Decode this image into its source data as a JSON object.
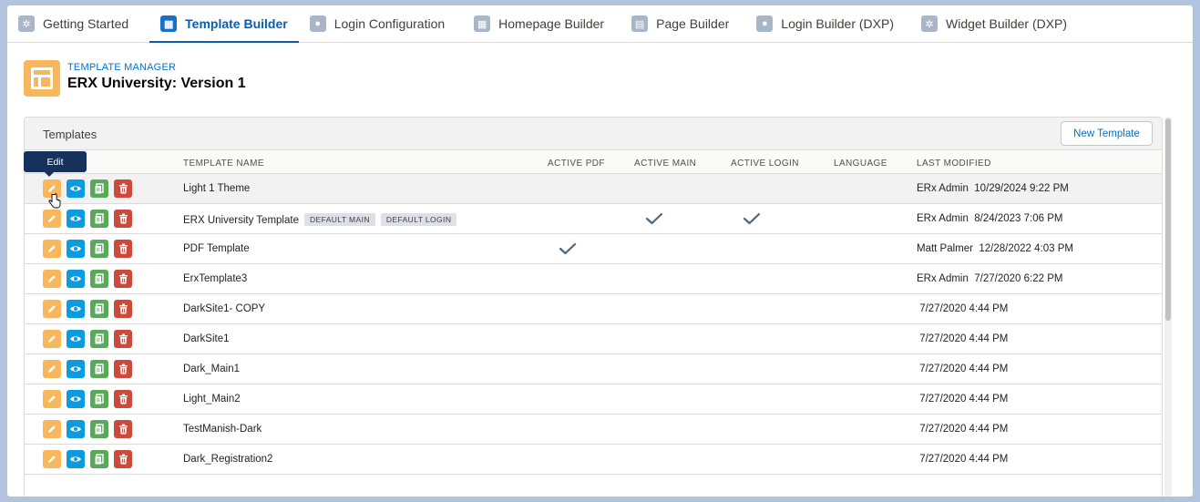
{
  "tabs": [
    {
      "label": "Getting Started",
      "icon": "gear-icon"
    },
    {
      "label": "Template Builder",
      "icon": "layout-icon",
      "active": true
    },
    {
      "label": "Login Configuration",
      "icon": "user-icon"
    },
    {
      "label": "Homepage Builder",
      "icon": "layout-icon"
    },
    {
      "label": "Page Builder",
      "icon": "page-icon"
    },
    {
      "label": "Login Builder (DXP)",
      "icon": "user-icon"
    },
    {
      "label": "Widget Builder (DXP)",
      "icon": "gear-icon"
    }
  ],
  "header": {
    "kicker": "TEMPLATE MANAGER",
    "title": "ERX University: Version 1"
  },
  "card": {
    "title": "Templates",
    "new_button": "New Template"
  },
  "columns": {
    "name": "TEMPLATE NAME",
    "active_pdf": "ACTIVE PDF",
    "active_main": "ACTIVE MAIN",
    "active_login": "ACTIVE LOGIN",
    "language": "LANGUAGE",
    "last_modified": "LAST MODIFIED"
  },
  "tooltip": "Edit",
  "rows": [
    {
      "name": "Light 1 Theme",
      "modified": "ERx Admin  10/29/2024 9:22 PM",
      "pdf": false,
      "main": false,
      "login": false
    },
    {
      "name": "ERX University Template",
      "badges": [
        "DEFAULT MAIN",
        "DEFAULT LOGIN"
      ],
      "modified": "ERx Admin  8/24/2023 7:06 PM",
      "pdf": false,
      "main": true,
      "login": true
    },
    {
      "name": "PDF Template",
      "modified": "Matt Palmer  12/28/2022 4:03 PM",
      "pdf": true,
      "main": false,
      "login": false
    },
    {
      "name": "ErxTemplate3",
      "modified": "ERx Admin  7/27/2020 6:22 PM",
      "pdf": false,
      "main": false,
      "login": false
    },
    {
      "name": "DarkSite1- COPY",
      "modified": " 7/27/2020 4:44 PM",
      "pdf": false,
      "main": false,
      "login": false
    },
    {
      "name": "DarkSite1",
      "modified": " 7/27/2020 4:44 PM",
      "pdf": false,
      "main": false,
      "login": false
    },
    {
      "name": "Dark_Main1",
      "modified": " 7/27/2020 4:44 PM",
      "pdf": false,
      "main": false,
      "login": false
    },
    {
      "name": "Light_Main2",
      "modified": " 7/27/2020 4:44 PM",
      "pdf": false,
      "main": false,
      "login": false
    },
    {
      "name": "TestManish-Dark",
      "modified": " 7/27/2020 4:44 PM",
      "pdf": false,
      "main": false,
      "login": false
    },
    {
      "name": "Dark_Registration2",
      "modified": " 7/27/2020 4:44 PM",
      "pdf": false,
      "main": false,
      "login": false
    }
  ]
}
